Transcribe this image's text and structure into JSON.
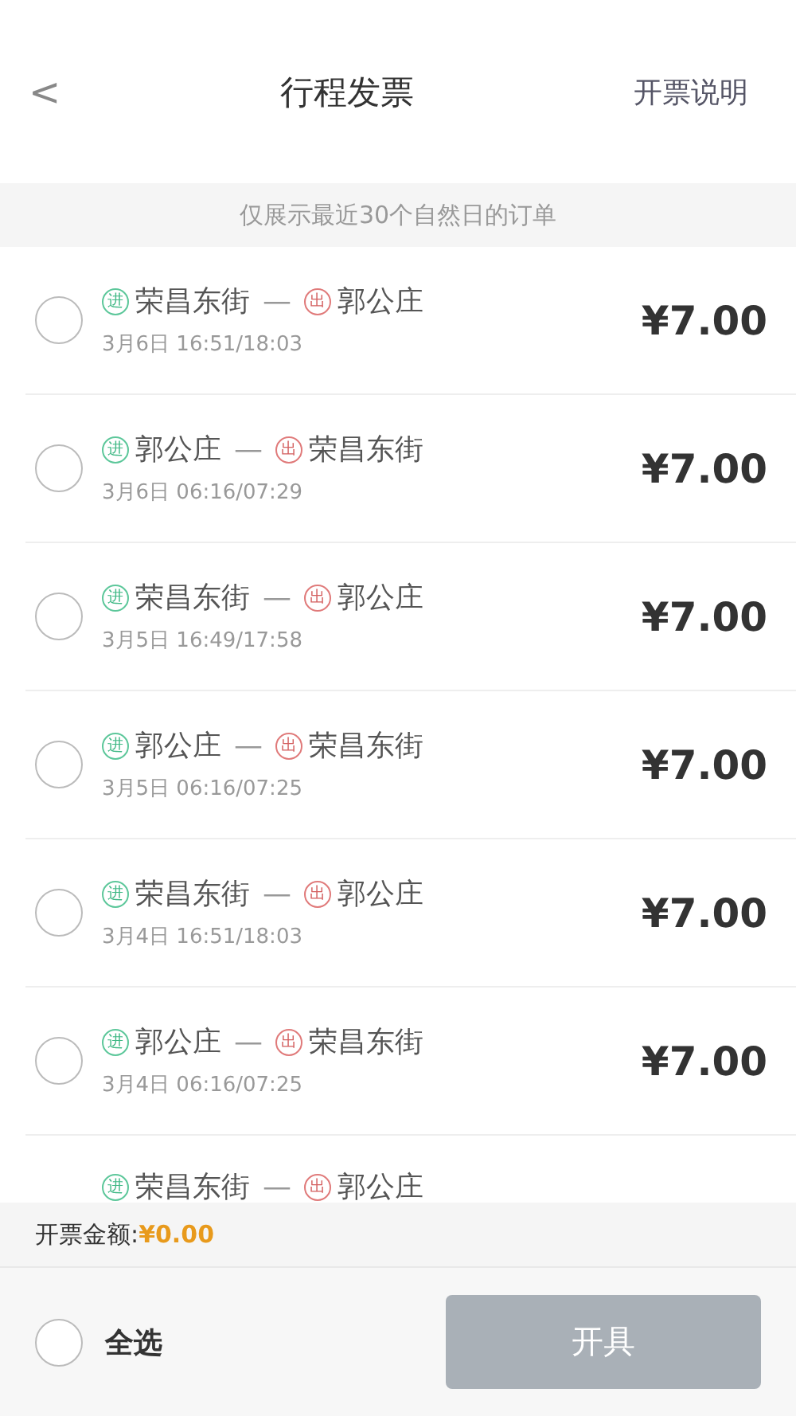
{
  "header": {
    "back": "<",
    "title": "行程发票",
    "action": "开票说明"
  },
  "notice": "仅展示最近30个自然日的订单",
  "orders": [
    {
      "selected": false,
      "from": {
        "kind": "enter",
        "mark": "进",
        "name": "荣昌东街"
      },
      "separator": "—",
      "to": {
        "kind": "exit",
        "mark": "出",
        "name": "郭公庄"
      },
      "time": "3月6日 16:51/18:03",
      "price": "¥7.00"
    },
    {
      "selected": false,
      "from": {
        "kind": "enter",
        "mark": "进",
        "name": "郭公庄"
      },
      "separator": "—",
      "to": {
        "kind": "exit",
        "mark": "出",
        "name": "荣昌东街"
      },
      "time": "3月6日 06:16/07:29",
      "price": "¥7.00"
    },
    {
      "selected": false,
      "from": {
        "kind": "enter",
        "mark": "进",
        "name": "荣昌东街"
      },
      "separator": "—",
      "to": {
        "kind": "exit",
        "mark": "出",
        "name": "郭公庄"
      },
      "time": "3月5日 16:49/17:58",
      "price": "¥7.00"
    },
    {
      "selected": false,
      "from": {
        "kind": "enter",
        "mark": "进",
        "name": "郭公庄"
      },
      "separator": "—",
      "to": {
        "kind": "exit",
        "mark": "出",
        "name": "荣昌东街"
      },
      "time": "3月5日 06:16/07:25",
      "price": "¥7.00"
    },
    {
      "selected": false,
      "from": {
        "kind": "enter",
        "mark": "进",
        "name": "荣昌东街"
      },
      "separator": "—",
      "to": {
        "kind": "exit",
        "mark": "出",
        "name": "郭公庄"
      },
      "time": "3月4日 16:51/18:03",
      "price": "¥7.00"
    },
    {
      "selected": false,
      "from": {
        "kind": "enter",
        "mark": "进",
        "name": "郭公庄"
      },
      "separator": "—",
      "to": {
        "kind": "exit",
        "mark": "出",
        "name": "荣昌东街"
      },
      "time": "3月4日 06:16/07:25",
      "price": "¥7.00"
    },
    {
      "from": {
        "kind": "enter",
        "mark": "进",
        "name": "荣昌东街"
      },
      "separator": "—",
      "to": {
        "kind": "exit",
        "mark": "出",
        "name": "郭公庄"
      }
    }
  ],
  "total": {
    "label": "开票金额:",
    "amount": "¥0.00"
  },
  "select_all": {
    "label": "全选",
    "selected": false
  },
  "submit": {
    "label": "开具",
    "disabled": true
  }
}
